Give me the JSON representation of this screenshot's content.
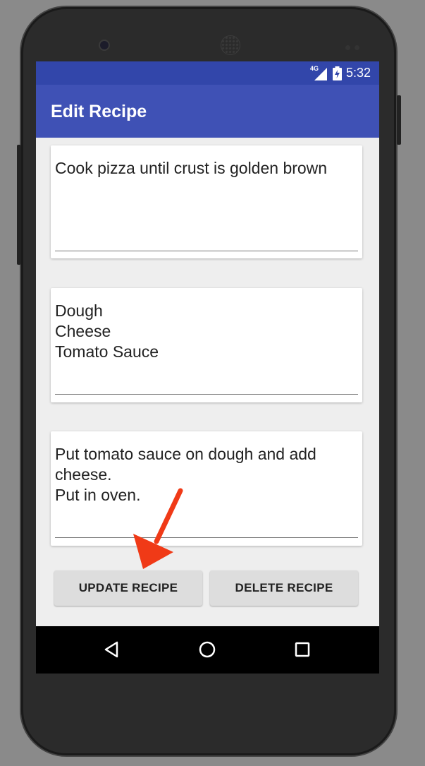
{
  "status_bar": {
    "network": "4G",
    "time": "5:32"
  },
  "app_bar": {
    "title": "Edit Recipe"
  },
  "fields": [
    {
      "name": "description",
      "value": "Cook pizza until crust is golden brown"
    },
    {
      "name": "ingredients",
      "value": "Dough\nCheese\nTomato Sauce"
    },
    {
      "name": "directions",
      "value": "Put tomato sauce on dough and add\ncheese.\nPut in oven."
    }
  ],
  "buttons": {
    "update_label": "UPDATE RECIPE",
    "delete_label": "DELETE RECIPE"
  },
  "navigation": [
    "back-icon",
    "home-icon",
    "recents-icon"
  ],
  "colors": {
    "app_bar": "#3f51b5",
    "status_bar": "#3246aa",
    "arrow": "#f03a17"
  }
}
